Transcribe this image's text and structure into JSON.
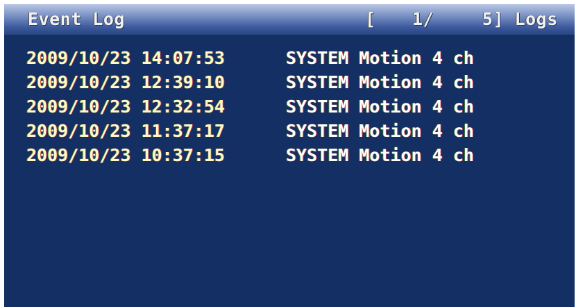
{
  "header": {
    "title": "Event Log",
    "pager_open": "[",
    "current_page": "1/",
    "total": "5]",
    "logs_label": "Logs"
  },
  "log_entries": [
    {
      "date_time": "2009/10/23 14:07:53",
      "source": "SYSTEM",
      "event": "Motion",
      "channel": "4 ch"
    },
    {
      "date_time": "2009/10/23 12:39:10",
      "source": "SYSTEM",
      "event": "Motion",
      "channel": "4 ch"
    },
    {
      "date_time": "2009/10/23 12:32:54",
      "source": "SYSTEM",
      "event": "Motion",
      "channel": "4 ch"
    },
    {
      "date_time": "2009/10/23 11:37:17",
      "source": "SYSTEM",
      "event": "Motion",
      "channel": "4 ch"
    },
    {
      "date_time": "2009/10/23 10:37:15",
      "source": "SYSTEM",
      "event": "Motion",
      "channel": "4 ch"
    }
  ],
  "colors": {
    "background": "#132f63",
    "timestamp": "#fff9c8",
    "text": "#ffffff"
  }
}
